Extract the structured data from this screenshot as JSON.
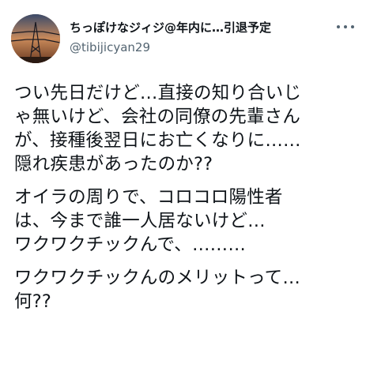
{
  "user": {
    "display_name": "ちっぽけなジィジ@年内に…引退予定",
    "handle": "@tibijicyan29",
    "avatar_icon": "power-tower-sunset-avatar"
  },
  "menu": {
    "icon": "more-horizontal-icon"
  },
  "tweet": {
    "paragraphs": [
      {
        "lines": [
          "つい先日だけど…直接の知り合いじ",
          "ゃ無いけど、会社の同僚の先輩さん",
          "が、接種後翌日にお亡くなりに……",
          "隠れ疾患があったのか??"
        ]
      },
      {
        "lines": [
          "オイラの周りで、コロコロ陽性者",
          "は、今まで誰一人居ないけど…",
          "ワクワクチックんで、………"
        ]
      },
      {
        "lines": [
          "ワクワクチックんのメリットって…",
          "何??"
        ]
      }
    ]
  }
}
